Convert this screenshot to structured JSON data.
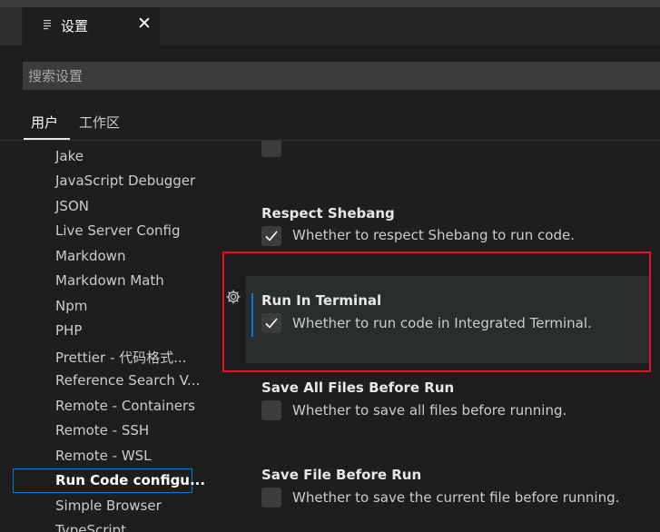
{
  "tab": {
    "icon": "settings-lines-icon",
    "title": "设置",
    "close_glyph": "✕"
  },
  "search": {
    "placeholder": "搜索设置",
    "value": ""
  },
  "scopes": {
    "user": "用户",
    "workspace": "工作区"
  },
  "toc": {
    "items": [
      {
        "label": "Jake"
      },
      {
        "label": "JavaScript Debugger"
      },
      {
        "label": "JSON"
      },
      {
        "label": "Live Server Config"
      },
      {
        "label": "Markdown"
      },
      {
        "label": "Markdown Math"
      },
      {
        "label": "Npm"
      },
      {
        "label": "PHP"
      },
      {
        "label": "Prettier - 代码格式..."
      },
      {
        "label": "Reference Search V..."
      },
      {
        "label": "Remote - Containers"
      },
      {
        "label": "Remote - SSH"
      },
      {
        "label": "Remote - WSL"
      },
      {
        "label": "Run Code configu..."
      },
      {
        "label": "Simple Browser"
      },
      {
        "label": "TypeScript"
      }
    ],
    "active_index": 13
  },
  "settings": [
    {
      "title": "Respect Shebang",
      "description": "Whether to respect Shebang to run code.",
      "checked": true
    },
    {
      "title": "Run In Terminal",
      "description": "Whether to run code in Integrated Terminal.",
      "checked": true
    },
    {
      "title": "Save All Files Before Run",
      "description": "Whether to save all files before running.",
      "checked": false
    },
    {
      "title": "Save File Before Run",
      "description": "Whether to save the current file before running.",
      "checked": false
    }
  ],
  "colors": {
    "background": "#1e1e1e",
    "accent_focus": "#007fd4",
    "highlight_border": "#e81123",
    "row_hover": "#2a2d2e"
  }
}
